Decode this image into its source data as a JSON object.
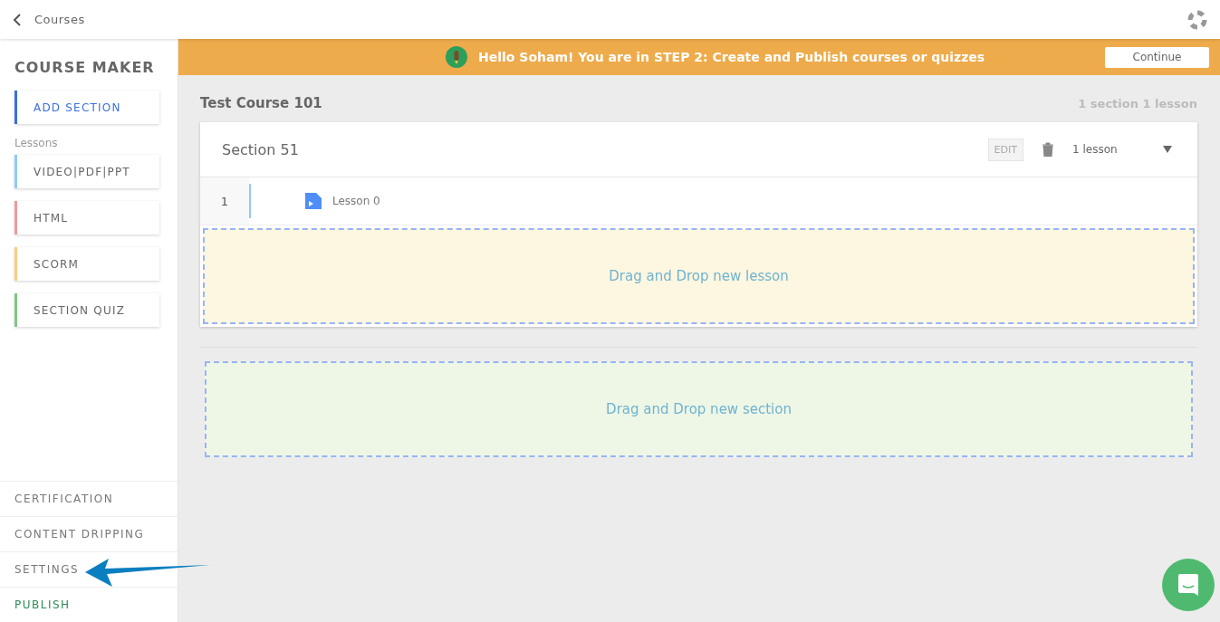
{
  "topbar": {
    "back_label": "Courses"
  },
  "sidebar": {
    "title": "COURSE MAKER",
    "add_section": "ADD SECTION",
    "lessons_label": "Lessons",
    "lesson_types": [
      {
        "label": "VIDEO|PDF|PPT",
        "color": "#90caf9"
      },
      {
        "label": "HTML",
        "color": "#ef9a9a"
      },
      {
        "label": "SCORM",
        "color": "#ffcc80"
      },
      {
        "label": "SECTION QUIZ",
        "color": "#81c784"
      }
    ],
    "bottom_items": [
      {
        "label": "CERTIFICATION",
        "highlighted": false
      },
      {
        "label": "CONTENT DRIPPING",
        "highlighted": false
      },
      {
        "label": "SETTINGS",
        "highlighted": false
      },
      {
        "label": "PUBLISH",
        "highlighted": true
      }
    ]
  },
  "banner": {
    "message": "Hello Soham! You are in STEP 2: Create and Publish courses or quizzes",
    "button": "Continue"
  },
  "course": {
    "title": "Test Course 101",
    "summary": "1 section 1 lesson",
    "sections": [
      {
        "title": "Section 51",
        "edit": "EDIT",
        "lesson_count": "1 lesson",
        "lessons": [
          {
            "number": "1",
            "title": "Lesson 0"
          }
        ],
        "drop_hint": "Drag and Drop new lesson"
      }
    ],
    "drop_section_hint": "Drag and Drop new section"
  }
}
